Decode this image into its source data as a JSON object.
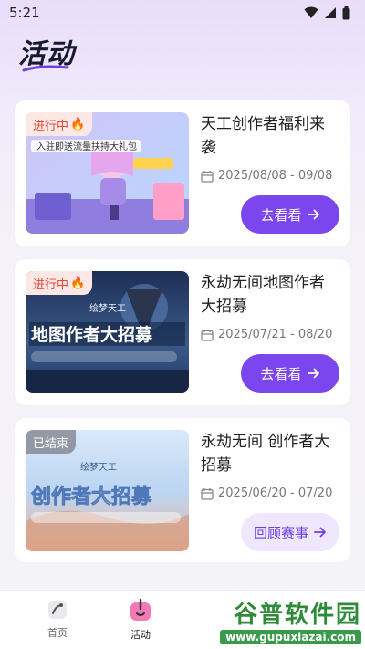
{
  "status_bar": {
    "time": "5:21"
  },
  "page": {
    "title": "活动"
  },
  "activities": [
    {
      "status": "进行中",
      "title": "天工创作者福利来袭",
      "date": "2025/08/08 - 09/08",
      "button": "去看看",
      "thumb_text": "入驻即送流量扶持大礼包"
    },
    {
      "status": "进行中",
      "title": "永劫无间地图作者大招募",
      "date": "2025/07/21 - 08/20",
      "button": "去看看",
      "thumb_text": "地图作者大招募",
      "thumb_brand": "绘梦天工"
    },
    {
      "status": "已结束",
      "title": "永劫无间 创作者大招募",
      "date": "2025/06/20 - 07/20",
      "button": "回顾赛事",
      "thumb_text": "创作者大招募",
      "thumb_brand": "绘梦天工"
    }
  ],
  "tabbar": {
    "items": [
      {
        "label": "首页",
        "icon": "home-icon"
      },
      {
        "label": "活动",
        "icon": "activity-icon"
      }
    ]
  },
  "watermark": {
    "main": "谷普软件园",
    "sub": "www.gupuxlazai.com"
  },
  "colors": {
    "accent": "#7c46ee",
    "badge_active": "#e14a3c"
  }
}
